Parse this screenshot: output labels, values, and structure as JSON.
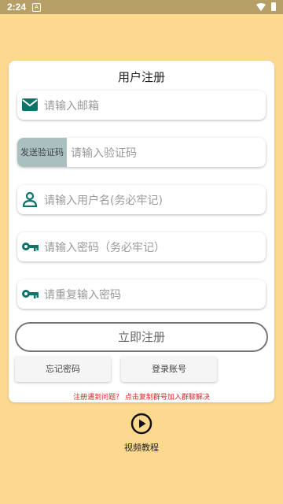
{
  "status_bar": {
    "time": "2:24",
    "notification": "A"
  },
  "form": {
    "title": "用户注册",
    "email_placeholder": "请输入邮箱",
    "send_code_label": "发送验证码",
    "code_placeholder": "请输入验证码",
    "username_placeholder": "请输入用户名(务必牢记)",
    "password_placeholder": "请输入密码（务必牢记）",
    "confirm_password_placeholder": "请重复输入密码",
    "register_label": "立即注册",
    "forgot_password_label": "忘记密码",
    "login_label": "登录账号",
    "help_text": "注册遇到问题？ 点击复制群号加入群聊解决"
  },
  "video": {
    "label": "视频教程"
  },
  "colors": {
    "background": "#fcd98f",
    "icon_teal": "#0d7368",
    "help_red": "#d42a2a",
    "code_button": "#a9bfc0"
  },
  "icons": {
    "email": "mail-icon",
    "user": "user-icon",
    "password": "key-icon",
    "confirm": "key-icon",
    "video": "play-circle-icon"
  }
}
